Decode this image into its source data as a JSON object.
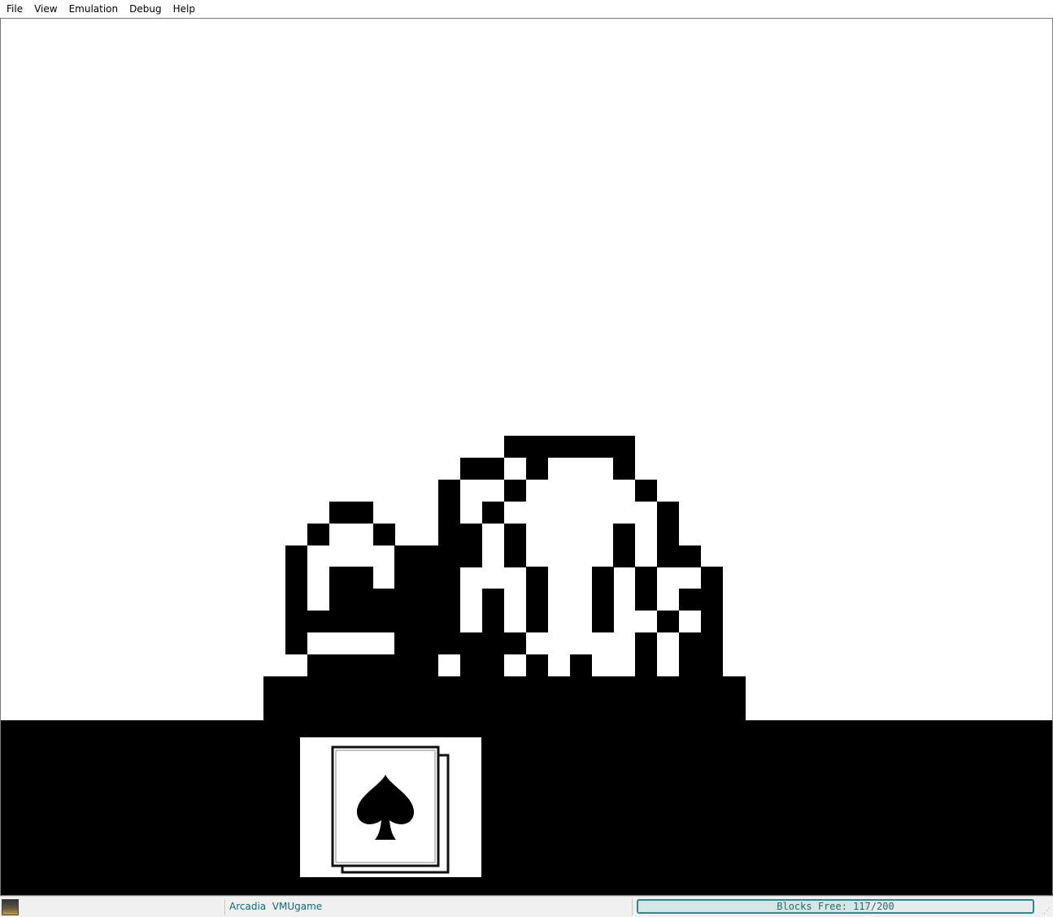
{
  "menubar": {
    "items": [
      "File",
      "View",
      "Emulation",
      "Debug",
      "Help"
    ]
  },
  "screen": {
    "description_icon": "vmu-lcd-display",
    "foreground_color": "#000000",
    "background_color": "#ffffff",
    "card_icon": "spade-card-icon"
  },
  "statusbar": {
    "app_icon": "arcadia-app-icon",
    "label": "Arcadia  VMUgame",
    "blocks_text": "Blocks Free: 117/200",
    "blocks_free": 117,
    "blocks_total": 200,
    "accent_color": "#2a8a8f"
  }
}
